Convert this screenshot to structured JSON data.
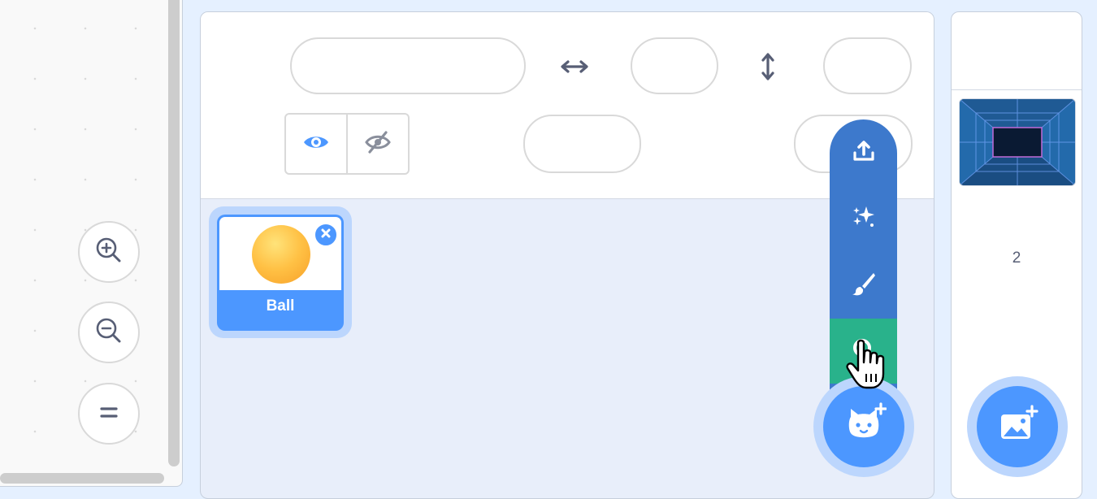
{
  "code_area": {
    "zoom_in_icon": "zoom-in-magnifier",
    "zoom_out_icon": "zoom-out-magnifier",
    "zoom_reset_icon": "equals"
  },
  "sprite_info": {
    "name_value": "",
    "x_value": "",
    "y_value": "",
    "size_value": "",
    "direction_value": "",
    "show_icon": "eye",
    "hide_icon": "eye-slash",
    "x_icon": "horizontal-arrows",
    "y_icon": "vertical-arrows"
  },
  "sprites": [
    {
      "name": "Ball",
      "selected": true
    }
  ],
  "sprite_menu": {
    "items": [
      "upload-sprite",
      "surprise",
      "paint",
      "choose-a-sprite"
    ],
    "active_item": "choose-a-sprite",
    "main_button_icon": "cat-plus"
  },
  "stage": {
    "backdrop_count": "2",
    "add_backdrop_icon": "image-plus"
  },
  "colors": {
    "accent": "#4c97ff",
    "menu_blue": "#3d79cc",
    "menu_active": "#29b28b",
    "background": "#e5f0ff"
  }
}
